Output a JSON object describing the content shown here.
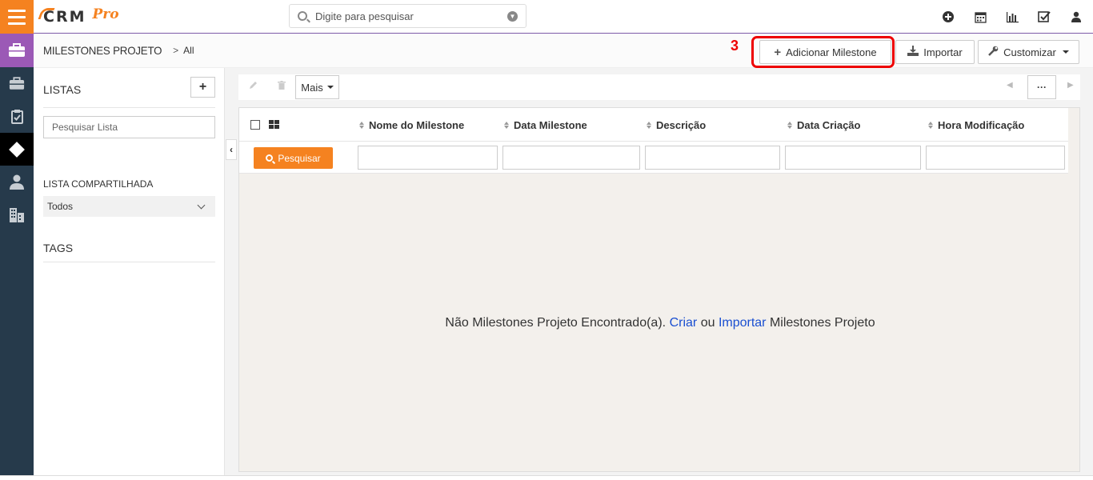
{
  "brand": {
    "logo_text": "CRM",
    "logo_suffix": "Pro",
    "accent": "#f58220",
    "sidebar_bg": "#263a4b",
    "purple": "#9b59b6"
  },
  "search": {
    "placeholder": "Digite para pesquisar"
  },
  "top_icons": [
    "plus-circle-icon",
    "calendar-icon",
    "bar-chart-icon",
    "checkbox-icon",
    "user-icon"
  ],
  "sidebar_icons": [
    "briefcase-icon",
    "briefcase-icon",
    "clipboard-icon",
    "diamond-icon",
    "person-icon",
    "building-icon"
  ],
  "breadcrumb": {
    "module": "MILESTONES PROJETO",
    "separator": ">",
    "current": "All"
  },
  "annotation": {
    "number": "3"
  },
  "actions": {
    "add": "Adicionar Milestone",
    "import": "Importar",
    "customize": "Customizar"
  },
  "lists": {
    "title": "LISTAS",
    "add_label": "+",
    "search_placeholder": "Pesquisar Lista",
    "shared_title": "LISTA COMPARTILHADA",
    "shared_value": "Todos",
    "tags_title": "TAGS"
  },
  "toolbar": {
    "more_label": "Mais",
    "dots_label": "···"
  },
  "table": {
    "columns": [
      "Nome do Milestone",
      "Data Milestone",
      "Descrição",
      "Data Criação",
      "Hora Modificação"
    ],
    "search_button": "Pesquisar"
  },
  "empty": {
    "prefix": "Não Milestones Projeto Encontrado(a).",
    "create": "Criar",
    "or": "ou",
    "import": "Importar",
    "suffix": "Milestones Projeto"
  }
}
